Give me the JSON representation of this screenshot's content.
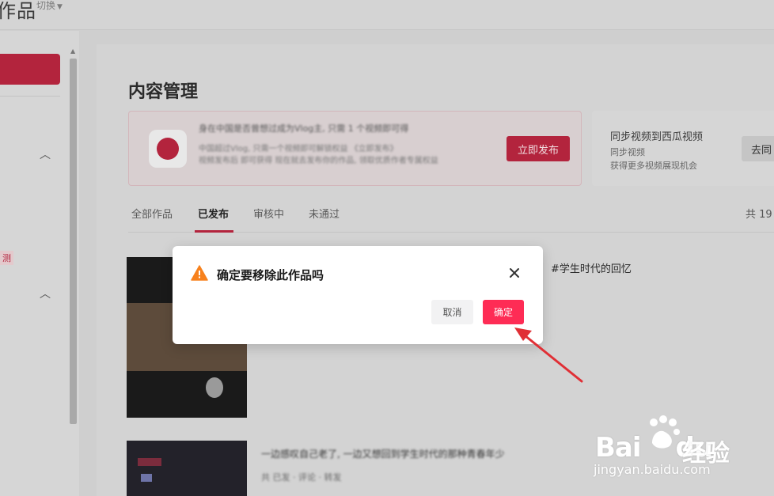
{
  "header": {
    "logo_fragment": "作品",
    "switch_label": "切换"
  },
  "sidebar": {
    "badge_fragment": "测"
  },
  "main": {
    "page_title": "内容管理",
    "promo": {
      "line1": "身在中国是否曾想过成为Vlog主, 只需 1 个视频即可得",
      "line2": "中国超过Vlog, 只需一个视频即可解锁权益 《立即发布》",
      "line3": "视频发布后 即可获得 现在就去发布你的作品, 领取优质作者专属权益",
      "publish_label": "立即发布"
    },
    "xigua": {
      "title": "同步视频到西瓜视频",
      "sub1": "同步视频",
      "sub2": "获得更多视频展现机会",
      "goto_label": "去同"
    },
    "tabs": [
      {
        "label": "全部作品"
      },
      {
        "label": "已发布"
      },
      {
        "label": "审核中"
      },
      {
        "label": "未通过"
      }
    ],
    "total_label": "共 19",
    "videos": [
      {
        "title": "#学生时代的回忆"
      },
      {
        "title": "一边感叹自己老了, 一边又想回到学生时代的那种青春年少",
        "meta": "共 已发 · 评论 · 转发"
      }
    ]
  },
  "modal": {
    "title": "确定要移除此作品吗",
    "cancel_label": "取消",
    "confirm_label": "确定",
    "icon": "warning-icon",
    "warning_color": "#f7811d",
    "confirm_color": "#fe2c55"
  },
  "annotation": {
    "arrow_color": "#e02f35"
  },
  "watermark": {
    "brand": "Bai",
    "brand_tail": "du",
    "chinese": "经验",
    "url": "jingyan.baidu.com"
  }
}
